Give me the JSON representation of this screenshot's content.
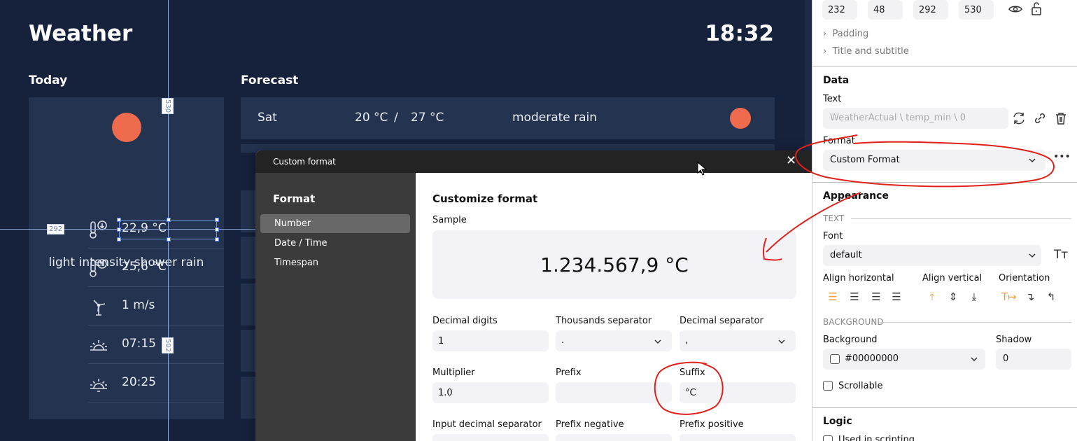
{
  "dashboard": {
    "title": "Weather",
    "time": "18:32",
    "today_title": "Today",
    "forecast_title": "Forecast",
    "today": {
      "description": "light intensity shower rain",
      "metrics": [
        {
          "icon": "thermometer-down-icon",
          "value": "22,9 °C"
        },
        {
          "icon": "thermometer-up-icon",
          "value": "25,6 °C"
        },
        {
          "icon": "wind-turbine-icon",
          "value": "1 m/s"
        },
        {
          "icon": "sunrise-icon",
          "value": "07:15"
        },
        {
          "icon": "sunset-icon",
          "value": "20:25"
        }
      ]
    },
    "forecast": [
      {
        "day": "Sat",
        "temp_min": "20 °C",
        "sep": "/",
        "temp_max": "27 °C",
        "description": "moderate rain"
      }
    ],
    "guides": {
      "v_label_top": "530",
      "v_label_bottom": "502",
      "h_label": "292"
    }
  },
  "dialog": {
    "title": "Custom format",
    "sidebar_title": "Format",
    "sidebar_items": [
      "Number",
      "Date / Time",
      "Timespan"
    ],
    "active_item": "Number",
    "main_title": "Customize format",
    "sample_label": "Sample",
    "sample_value": "1.234.567,9 °C",
    "fields": {
      "decimal_digits": {
        "label": "Decimal digits",
        "value": "1"
      },
      "thousands_separator": {
        "label": "Thousands separator",
        "value": "."
      },
      "decimal_separator": {
        "label": "Decimal separator",
        "value": ","
      },
      "multiplier": {
        "label": "Multiplier",
        "value": "1.0"
      },
      "prefix": {
        "label": "Prefix",
        "value": ""
      },
      "suffix": {
        "label": "Suffix",
        "value": "°C"
      },
      "input_decimal_separator": {
        "label": "Input decimal separator"
      },
      "prefix_negative": {
        "label": "Prefix negative"
      },
      "prefix_positive": {
        "label": "Prefix positive"
      }
    }
  },
  "panel": {
    "position": [
      "232",
      "48",
      "292",
      "530"
    ],
    "padding_label": "Padding",
    "title_subtitle_label": "Title and subtitle",
    "data_title": "Data",
    "text_label": "Text",
    "text_value": "WeatherActual \\ temp_min \\ 0",
    "format_label": "Format",
    "format_value": "Custom Format",
    "appearance_title": "Appearance",
    "text_section": "TEXT",
    "font_label": "Font",
    "font_value": "default",
    "align_horizontal": "Align horizontal",
    "align_vertical": "Align vertical",
    "orientation": "Orientation",
    "background_section": "BACKGROUND",
    "background_label": "Background",
    "background_value": "#00000000",
    "shadow_label": "Shadow",
    "shadow_value": "0",
    "scrollable_label": "Scrollable",
    "logic_title": "Logic",
    "used_in_scripting": "Used in scripting"
  }
}
